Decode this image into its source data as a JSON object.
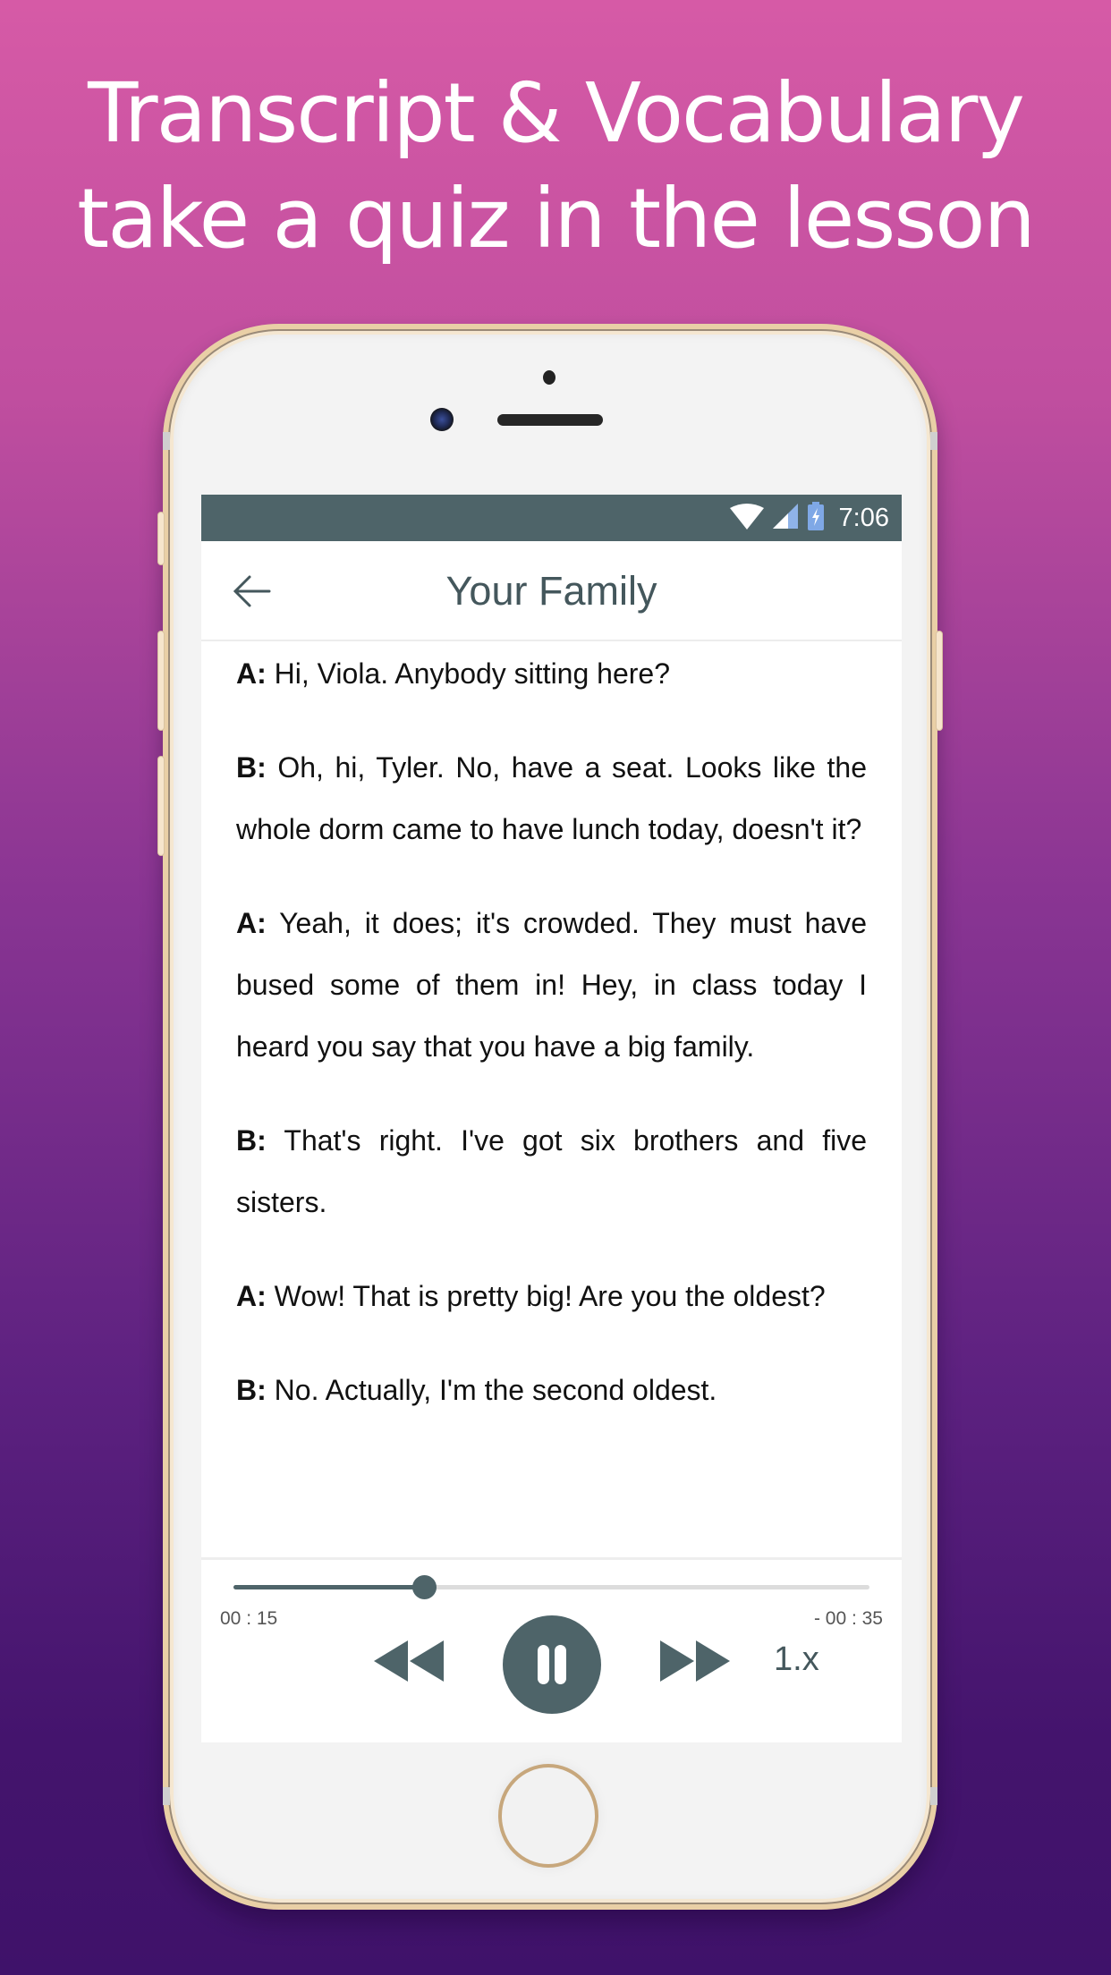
{
  "promo": {
    "headline_line1": "Transcript & Vocabulary",
    "headline_line2": "take a quiz in the lesson"
  },
  "status_bar": {
    "time": "7:06",
    "icons": [
      "wifi-icon",
      "cell-signal-icon",
      "battery-charging-icon"
    ],
    "color": "#4e6469"
  },
  "header": {
    "back_icon": "arrow-left-icon",
    "title": "Your Family"
  },
  "transcript": [
    {
      "speaker": "A:",
      "text": "Hi, Viola. Anybody sitting here?"
    },
    {
      "speaker": "B:",
      "text": "Oh, hi, Tyler. No, have a seat. Looks like the whole dorm came to have lunch today, doesn't it?"
    },
    {
      "speaker": "A:",
      "text": "Yeah, it does; it's crowded. They must have bused some of them in! Hey, in class today I heard you say that you have a big family."
    },
    {
      "speaker": "B:",
      "text": "That's right. I've got six brothers and five sisters."
    },
    {
      "speaker": "A:",
      "text": "Wow! That is pretty big! Are you the oldest?"
    },
    {
      "speaker": "B:",
      "text": "No. Actually, I'm the second oldest."
    }
  ],
  "player": {
    "elapsed": "00 : 15",
    "remaining": "- 00 : 35",
    "progress_fraction": 0.3,
    "state": "playing",
    "speed_label": "1.x",
    "icons": {
      "rewind": "rewind-icon",
      "play_pause": "pause-icon",
      "forward": "fast-forward-icon"
    },
    "accent_color": "#4e6469"
  }
}
